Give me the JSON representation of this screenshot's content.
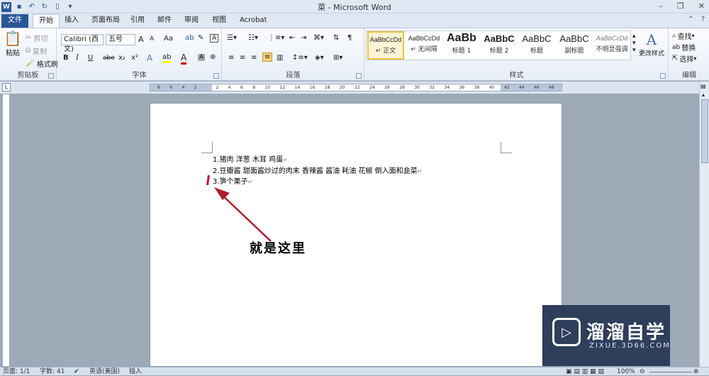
{
  "window": {
    "title": "菜 - Microsoft Word",
    "qat_icons": [
      "word-icon",
      "save-icon",
      "undo-icon",
      "redo-icon",
      "new-document-icon",
      "customize-icon"
    ]
  },
  "tabs": [
    "文件",
    "开始",
    "插入",
    "页面布局",
    "引用",
    "邮件",
    "审阅",
    "视图",
    "Acrobat"
  ],
  "ribbon": {
    "clipboard": {
      "paste": "粘贴",
      "cut": "剪切",
      "copy": "复制",
      "format_painter": "格式刷",
      "label": "剪贴板"
    },
    "font": {
      "font_name": "Calibri (西文)",
      "font_size": "五号",
      "grow": "A",
      "shrink": "A",
      "case": "Aa",
      "bold": "B",
      "italic": "I",
      "underline": "U",
      "strike": "abe",
      "subscript": "x₂",
      "superscript": "x²",
      "label": "字体"
    },
    "paragraph": {
      "label": "段落"
    },
    "styles": {
      "label": "样式",
      "change_styles": "更改样式",
      "items": [
        {
          "sample": "AaBbCcDd",
          "name": "↵ 正文"
        },
        {
          "sample": "AaBbCcDd",
          "name": "↵ 无间隔"
        },
        {
          "sample": "AaBb",
          "name": "标题 1"
        },
        {
          "sample": "AaBbC",
          "name": "标题 2"
        },
        {
          "sample": "AaBbC",
          "name": "标题"
        },
        {
          "sample": "AaBbC",
          "name": "副标题"
        },
        {
          "sample": "AaBbCcDd",
          "name": "不明显强调"
        }
      ]
    },
    "editing": {
      "label": "编辑",
      "find": "查找",
      "replace": "替换",
      "select": "选择"
    }
  },
  "ruler": {
    "ticks": [
      "8",
      "6",
      "4",
      "2",
      "",
      "2",
      "4",
      "6",
      "8",
      "10",
      "12",
      "14",
      "16",
      "18",
      "20",
      "22",
      "24",
      "26",
      "28",
      "30",
      "32",
      "34",
      "36",
      "38",
      "40",
      "42",
      "44",
      "46",
      "48"
    ]
  },
  "document": {
    "lines": [
      "1.猪肉  洋葱  木耳  鸡蛋",
      "2.豆瓣酱  甜面酱炒过的肉末  香辣酱  酱油  耗油  花椒  倒入面和韭菜",
      "3.笋个栗子"
    ],
    "para_mark": "↵",
    "annotation": "就是这里"
  },
  "watermark": {
    "title": "溜溜自学",
    "url": "ZIXUE.3D66.COM"
  },
  "statusbar": {
    "page": "页面: 1/1",
    "words": "字数: 41",
    "language": "英语(美国)",
    "mode": "插入",
    "zoom": "100%"
  },
  "colors": {
    "accent": "#2a5699",
    "arrow": "#b01e2e",
    "watermark_bg": "#2e3e5b"
  }
}
